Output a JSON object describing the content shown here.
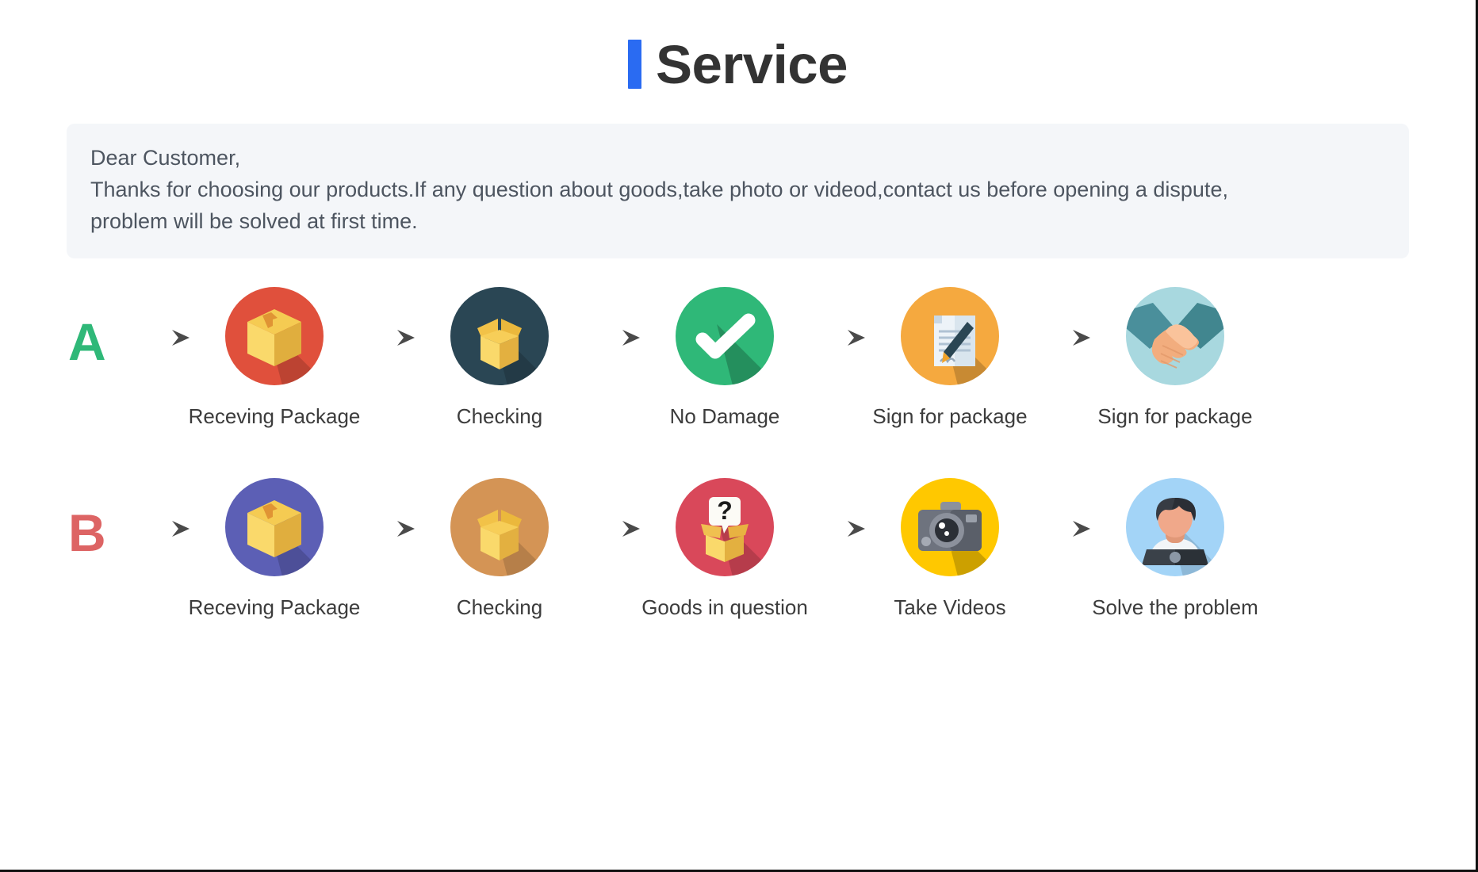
{
  "header": {
    "accent_color": "#2A6BF2",
    "title": "Service"
  },
  "notice": {
    "background": "#F4F6F9",
    "lines": [
      "Dear Customer,",
      "Thanks for choosing our products.If any question about goods,take photo or videod,contact us before opening a dispute,",
      "problem will be solved at first time."
    ]
  },
  "flows": [
    {
      "letter": "A",
      "letter_color": "#2FB878",
      "steps": [
        {
          "label": "Receving Package",
          "icon": "closed-package-icon",
          "circle_color": "#E0503C"
        },
        {
          "label": "Checking",
          "icon": "open-box-icon",
          "circle_color": "#2A4654"
        },
        {
          "label": "No Damage",
          "icon": "check-mark-icon",
          "circle_color": "#2FB878"
        },
        {
          "label": "Sign for package",
          "icon": "document-pen-icon",
          "circle_color": "#F5A93F"
        },
        {
          "label": "Sign for package",
          "icon": "handshake-icon",
          "circle_color": "#A8D8DF"
        }
      ]
    },
    {
      "letter": "B",
      "letter_color": "#DD6464",
      "steps": [
        {
          "label": "Receving Package",
          "icon": "closed-package-icon",
          "circle_color": "#5C5FB5"
        },
        {
          "label": "Checking",
          "icon": "open-box-icon",
          "circle_color": "#D49455"
        },
        {
          "label": "Goods in question",
          "icon": "question-box-icon",
          "circle_color": "#D9485A"
        },
        {
          "label": "Take Videos",
          "icon": "camera-icon",
          "circle_color": "#FFC800"
        },
        {
          "label": "Solve the problem",
          "icon": "support-person-icon",
          "circle_color": "#A3D4F7"
        }
      ]
    }
  ],
  "arrow": {
    "name": "right-arrow-icon",
    "color": "#5A5A5A"
  }
}
